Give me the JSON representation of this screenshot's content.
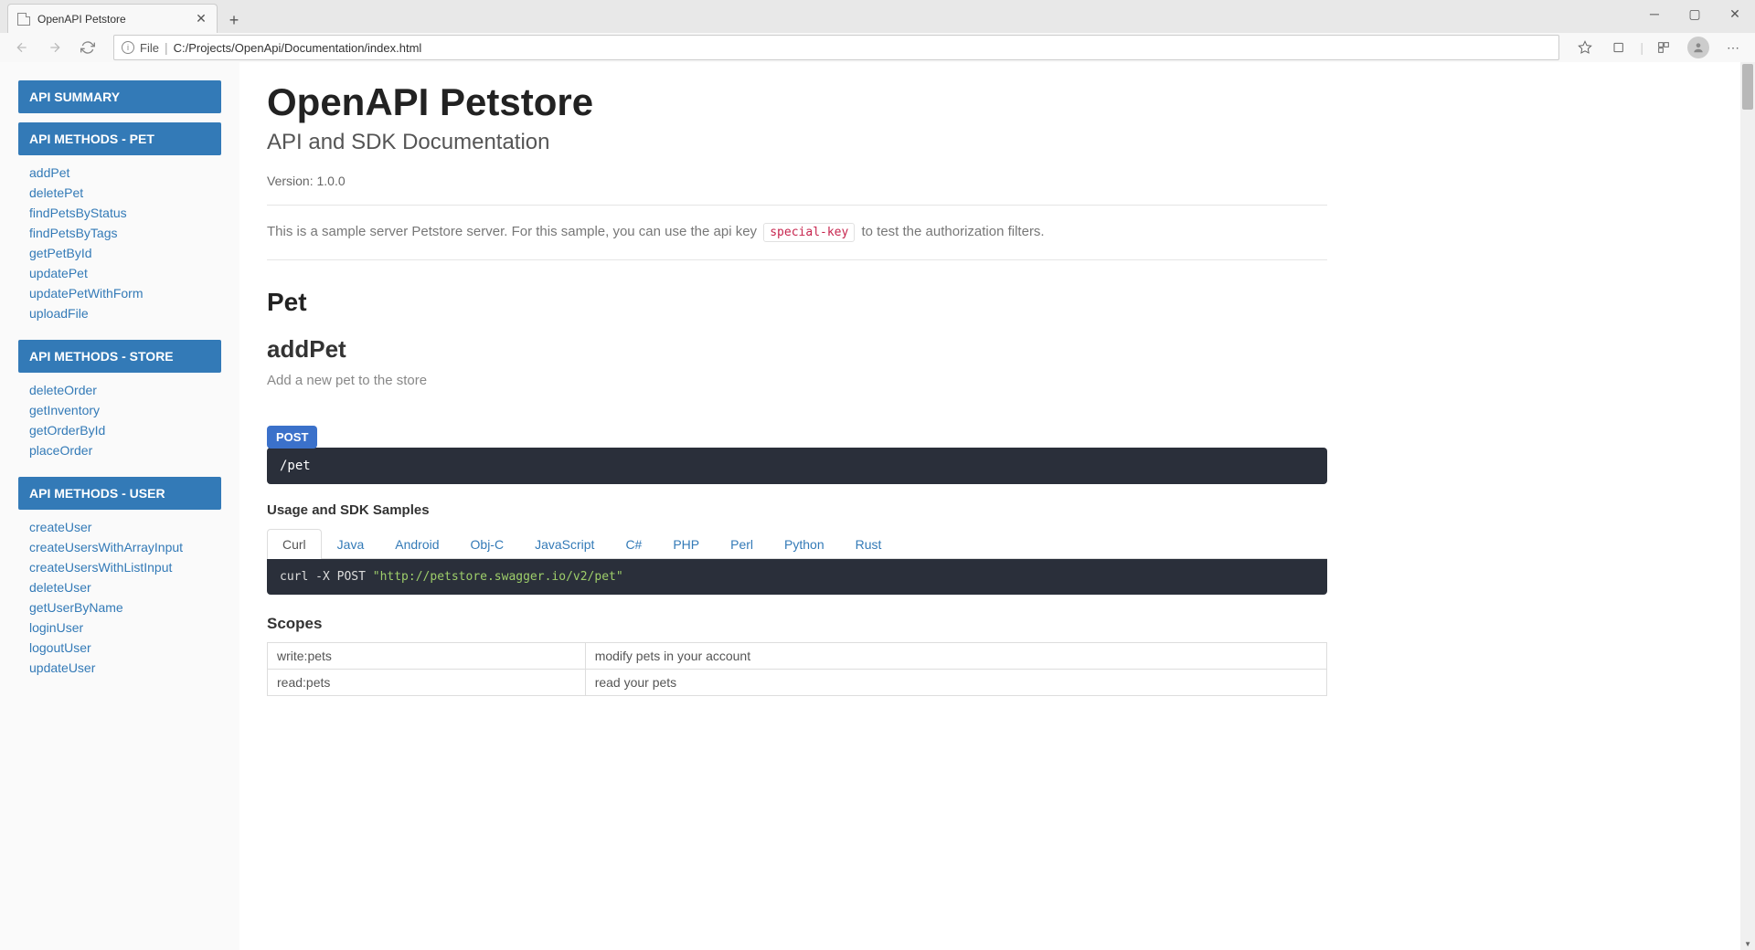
{
  "browser": {
    "tab_title": "OpenAPI Petstore",
    "file_label": "File",
    "url": "C:/Projects/OpenApi/Documentation/index.html"
  },
  "sidebar": {
    "sections": [
      {
        "title": "API SUMMARY",
        "links": []
      },
      {
        "title": "API METHODS - PET",
        "links": [
          "addPet",
          "deletePet",
          "findPetsByStatus",
          "findPetsByTags",
          "getPetById",
          "updatePet",
          "updatePetWithForm",
          "uploadFile"
        ]
      },
      {
        "title": "API METHODS - STORE",
        "links": [
          "deleteOrder",
          "getInventory",
          "getOrderById",
          "placeOrder"
        ]
      },
      {
        "title": "API METHODS - USER",
        "links": [
          "createUser",
          "createUsersWithArrayInput",
          "createUsersWithListInput",
          "deleteUser",
          "getUserByName",
          "loginUser",
          "logoutUser",
          "updateUser"
        ]
      }
    ]
  },
  "page": {
    "title": "OpenAPI Petstore",
    "subtitle": "API and SDK Documentation",
    "version_label": "Version: 1.0.0",
    "desc_before": "This is a sample server Petstore server. For this sample, you can use the api key ",
    "desc_code": "special-key",
    "desc_after": " to test the authorization filters.",
    "section": "Pet",
    "endpoint": {
      "name": "addPet",
      "summary": "Add a new pet to the store",
      "method": "POST",
      "path": "/pet",
      "usage_title": "Usage and SDK Samples",
      "tabs": [
        "Curl",
        "Java",
        "Android",
        "Obj-C",
        "JavaScript",
        "C#",
        "PHP",
        "Perl",
        "Python",
        "Rust"
      ],
      "curl_cmd": "curl -X POST ",
      "curl_url": "\"http://petstore.swagger.io/v2/pet\"",
      "scopes_title": "Scopes",
      "scopes": [
        {
          "name": "write:pets",
          "desc": "modify pets in your account"
        },
        {
          "name": "read:pets",
          "desc": "read your pets"
        }
      ]
    }
  }
}
